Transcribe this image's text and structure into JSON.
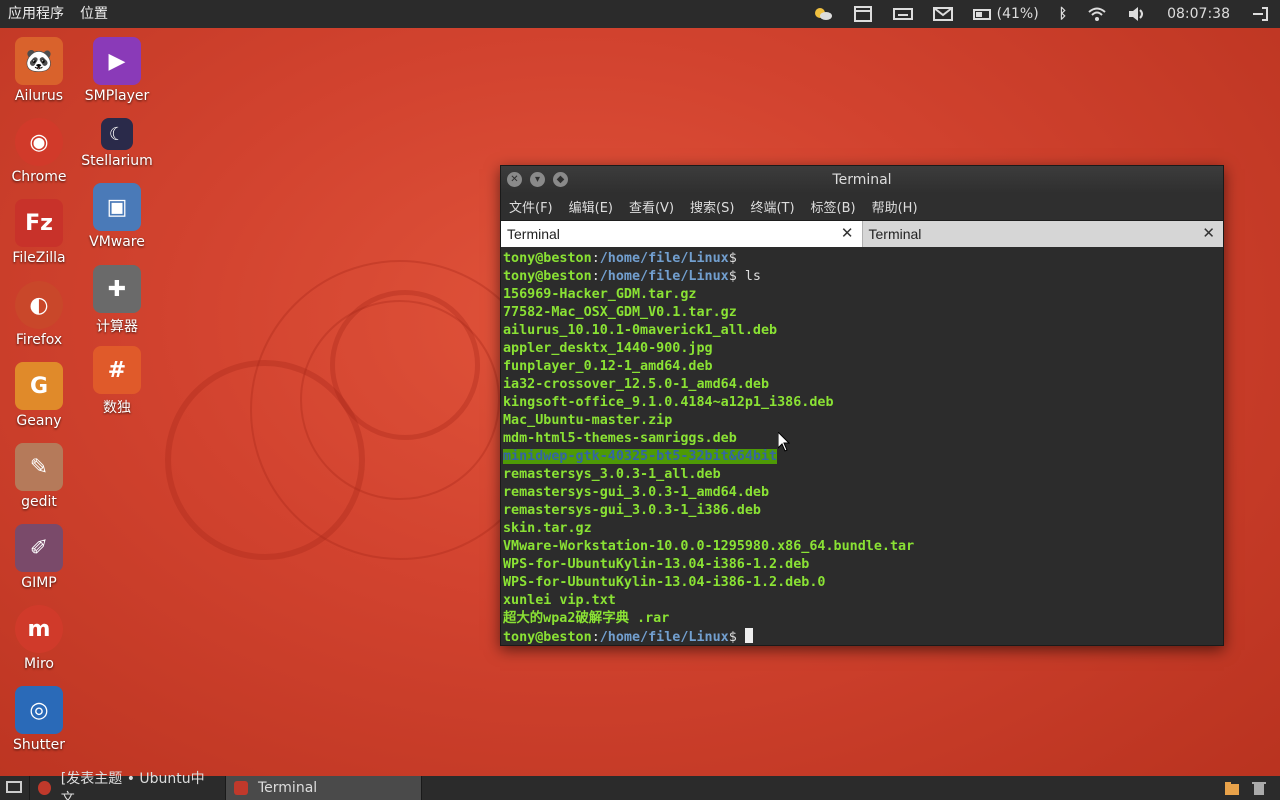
{
  "top_panel": {
    "menus": [
      "应用程序",
      "位置"
    ],
    "battery": "(41%)",
    "clock": "08:07:38"
  },
  "desktop_icons": [
    {
      "name": "ailurus",
      "label": "Ailurus",
      "color": "#d9622c",
      "glyph": "A"
    },
    {
      "name": "chrome",
      "label": "Chrome",
      "color": "#d13a2a",
      "glyph": "◉"
    },
    {
      "name": "filezilla",
      "label": "FileZilla",
      "color": "#c8322a",
      "glyph": "Fz"
    },
    {
      "name": "firefox",
      "label": "Firefox",
      "color": "#c9472a",
      "glyph": "◐"
    },
    {
      "name": "geany",
      "label": "Geany",
      "color": "#e08a2a",
      "glyph": "G"
    },
    {
      "name": "gedit",
      "label": "gedit",
      "color": "#b57a5a",
      "glyph": "✎"
    },
    {
      "name": "gimp",
      "label": "GIMP",
      "color": "#7a4a6a",
      "glyph": "✐"
    },
    {
      "name": "miro",
      "label": "Miro",
      "color": "#d03a2a",
      "glyph": "m"
    },
    {
      "name": "shutter",
      "label": "Shutter",
      "color": "#2a6ab8",
      "glyph": "◎"
    },
    {
      "name": "smplayer",
      "label": "SMPlayer",
      "color": "#8a3ab8",
      "glyph": "▶"
    },
    {
      "name": "stellarium",
      "label": "Stellarium",
      "color": "#2a2a4a",
      "glyph": "☾"
    },
    {
      "name": "vmware",
      "label": "VMware",
      "color": "#4a7ab8",
      "glyph": "▣"
    },
    {
      "name": "calculator",
      "label": "计算器",
      "color": "#6a6a6a",
      "glyph": "✚"
    },
    {
      "name": "sudoku",
      "label": "数独",
      "color": "#e05a2a",
      "glyph": "#"
    }
  ],
  "terminal": {
    "title": "Terminal",
    "menu": [
      "文件(F)",
      "编辑(E)",
      "查看(V)",
      "搜索(S)",
      "终端(T)",
      "标签(B)",
      "帮助(H)"
    ],
    "tabs": [
      "Terminal",
      "Terminal"
    ],
    "prompt_user": "tony@beston",
    "prompt_path": "/home/file/Linux",
    "prompt_symbol": "$",
    "command": " ls",
    "files": [
      "156969-Hacker_GDM.tar.gz",
      "77582-Mac_OSX_GDM_V0.1.tar.gz",
      "ailurus_10.10.1-0maverick1_all.deb",
      "appler_desktx_1440-900.jpg",
      "funplayer_0.12-1_amd64.deb",
      "ia32-crossover_12.5.0-1_amd64.deb",
      "kingsoft-office_9.1.0.4184~a12p1_i386.deb",
      "Mac_Ubuntu-master.zip",
      "mdm-html5-themes-samriggs.deb",
      "minidwep-gtk-40325-bt5-32bit&64bit",
      "remastersys_3.0.3-1_all.deb",
      "remastersys-gui_3.0.3-1_amd64.deb",
      "remastersys-gui_3.0.3-1_i386.deb",
      "skin.tar.gz",
      "VMware-Workstation-10.0.0-1295980.x86_64.bundle.tar",
      "WPS-for-UbuntuKylin-13.04-i386-1.2.deb",
      "WPS-for-UbuntuKylin-13.04-i386-1.2.deb.0",
      "xunlei vip.txt",
      "超大的wpa2破解字典 .rar"
    ],
    "highlighted_file": "minidwep-gtk-40325-bt5-32bit&64bit"
  },
  "taskbar": {
    "tasks": [
      "[发表主题 • Ubuntu中文...",
      "Terminal"
    ]
  }
}
